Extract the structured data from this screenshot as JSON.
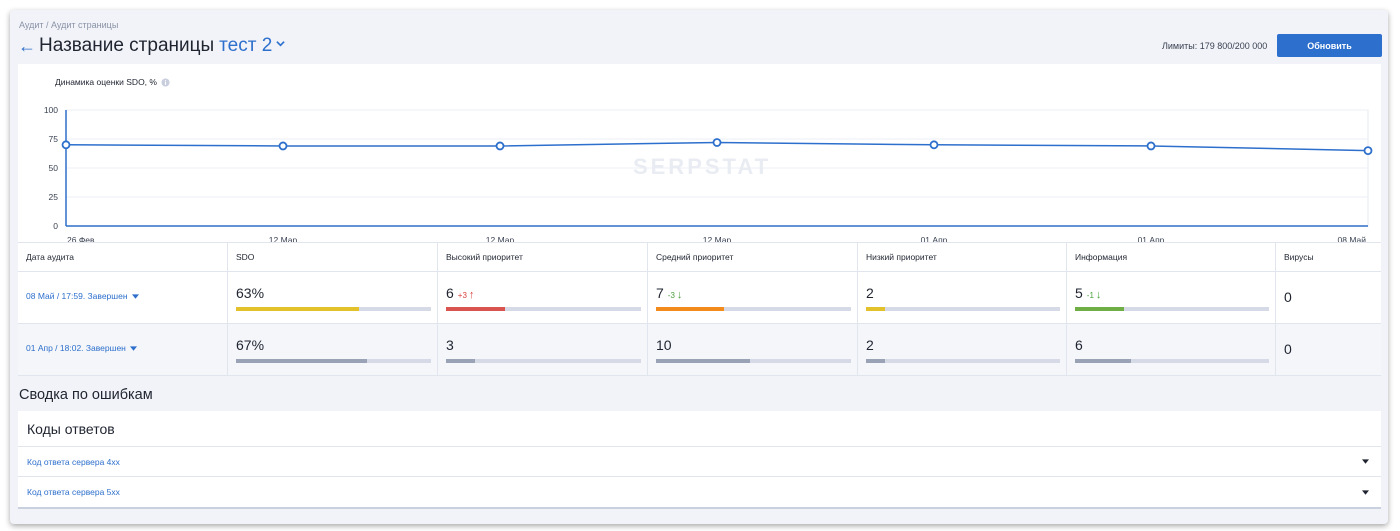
{
  "breadcrumb": {
    "root": "Аудит",
    "separator": " / ",
    "current": "Аудит страницы"
  },
  "header": {
    "back_icon": "arrow-left-icon",
    "title": "Название страницы",
    "project": "тест 2",
    "project_dropdown_icon": "chevron-down-icon",
    "limits": "Лимиты: 179 800/200 000",
    "refresh_label": "Обновить"
  },
  "colors": {
    "accent": "#2d6fcc",
    "sdo_bar": "#e2c12a",
    "high_bar": "#d9534f",
    "medium_bar": "#f28a1c",
    "low_bar": "#e2c12a",
    "info_bar": "#6fae45",
    "neutral_bar": "#9aa3b5"
  },
  "chart": {
    "title": "Динамика оценки SDO, %",
    "info_icon": "info-icon",
    "watermark": "SERPSTAT"
  },
  "chart_data": {
    "type": "line",
    "title": "Динамика оценки SDO, %",
    "x": [
      "26 Фев",
      "12 Мар",
      "12 Мар",
      "12 Мар",
      "01 Апр",
      "01 Апр",
      "08 Май"
    ],
    "series": [
      {
        "values": [
          70,
          69,
          69,
          72,
          70,
          69,
          65
        ]
      }
    ],
    "yticks": [
      0,
      25,
      50,
      75,
      100
    ],
    "ylim": [
      0,
      100
    ],
    "grid": true
  },
  "table": {
    "headers": [
      "Дата аудита",
      "SDO",
      "Высокий приоритет",
      "Средний приоритет",
      "Низкий приоритет",
      "Информация",
      "Вирусы"
    ],
    "rows": [
      {
        "date": "08 Май / 17:59. Завершен",
        "sdo": "63%",
        "sdo_fill": 0.63,
        "high": "6",
        "high_delta": "+3",
        "high_fill": 0.3,
        "medium": "7",
        "medium_delta": "-3",
        "medium_fill": 0.35,
        "low": "2",
        "low_fill": 0.1,
        "info": "5",
        "info_delta": "-1",
        "info_fill": 0.25,
        "virus": "0"
      },
      {
        "date": "01 Апр / 18:02. Завершен",
        "sdo": "67%",
        "sdo_fill": 0.67,
        "high": "3",
        "high_fill": 0.15,
        "medium": "10",
        "medium_fill": 0.48,
        "low": "2",
        "low_fill": 0.1,
        "info": "6",
        "info_fill": 0.29,
        "virus": "0"
      }
    ]
  },
  "summary": {
    "title": "Сводка по ошибкам",
    "card_title": "Коды ответов",
    "items": [
      "Код ответа сервера 4xx",
      "Код ответа сервера 5xx"
    ]
  }
}
